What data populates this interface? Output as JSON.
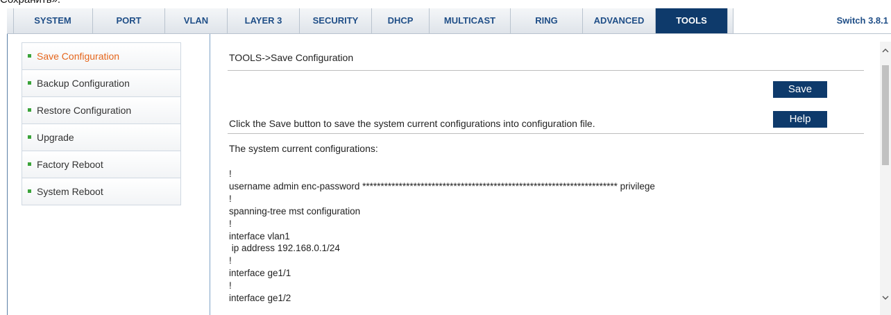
{
  "cut_text": "Сохранить».",
  "nav": {
    "tabs": [
      {
        "label": "SYSTEM"
      },
      {
        "label": "PORT"
      },
      {
        "label": "VLAN"
      },
      {
        "label": "LAYER 3"
      },
      {
        "label": "SECURITY"
      },
      {
        "label": "DHCP"
      },
      {
        "label": "MULTICAST"
      },
      {
        "label": "RING"
      },
      {
        "label": "ADVANCED"
      },
      {
        "label": "TOOLS"
      }
    ],
    "active_tab": "TOOLS",
    "version": "Switch 3.8.1"
  },
  "sidebar": {
    "items": [
      {
        "label": "Save Configuration"
      },
      {
        "label": "Backup Configuration"
      },
      {
        "label": "Restore Configuration"
      },
      {
        "label": "Upgrade"
      },
      {
        "label": "Factory Reboot"
      },
      {
        "label": "System Reboot"
      }
    ],
    "active_item": "Save Configuration"
  },
  "main": {
    "breadcrumb": "TOOLS->Save Configuration",
    "description": "Click the Save button to save the system current configurations into configuration file.",
    "save_label": "Save",
    "help_label": "Help",
    "config_title": "The system current configurations:",
    "config_lines": [
      "!",
      "username admin enc-password ********************************************************************** privilege",
      "!",
      "spanning-tree mst configuration",
      "!",
      "interface vlan1",
      " ip address 192.168.0.1/24",
      "!",
      "interface ge1/1",
      "!",
      "interface ge1/2"
    ]
  },
  "colors": {
    "nav_active_bg": "#0e3a6b",
    "nav_text": "#1f4e87",
    "active_item_text": "#e5651b",
    "bullet": "#3aa33a",
    "button_bg": "#0e3a6b"
  }
}
